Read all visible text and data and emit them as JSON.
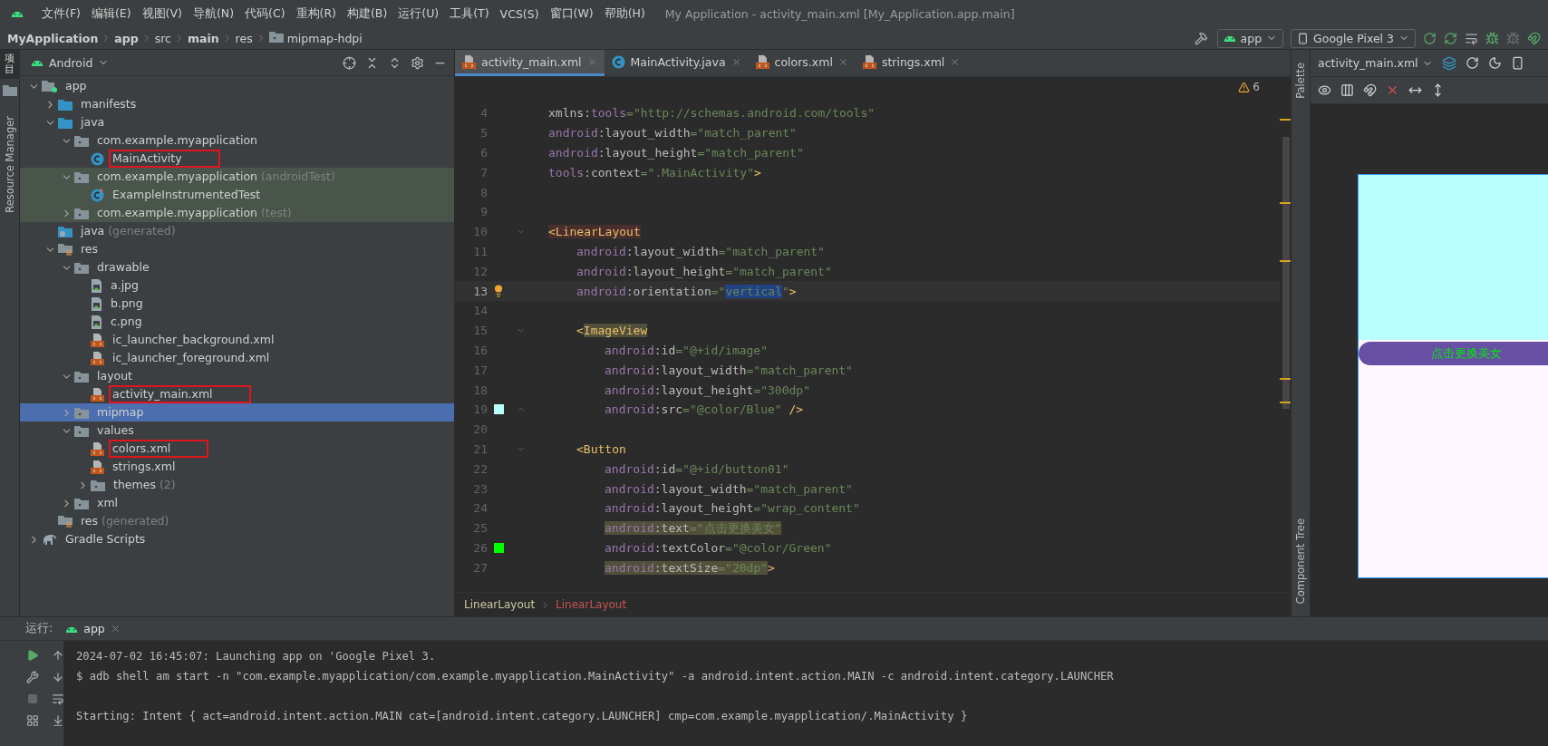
{
  "menu_bar": {
    "items": [
      "文件(F)",
      "编辑(E)",
      "视图(V)",
      "导航(N)",
      "代码(C)",
      "重构(R)",
      "构建(B)",
      "运行(U)",
      "工具(T)",
      "VCS(S)",
      "窗口(W)",
      "帮助(H)"
    ],
    "title": "My Application - activity_main.xml [My_Application.app.main]"
  },
  "breadcrumb": [
    {
      "label": "MyApplication",
      "bold": true
    },
    {
      "label": "app",
      "bold": true
    },
    {
      "label": "src",
      "bold": false
    },
    {
      "label": "main",
      "bold": true
    },
    {
      "label": "res",
      "bold": false
    },
    {
      "label": "mipmap-hdpi",
      "bold": false,
      "kind": "folder"
    }
  ],
  "run_toolbar": {
    "config": "app",
    "device": "Google Pixel 3"
  },
  "side_tabs": {
    "project": "项目",
    "resources": "Resource Manager"
  },
  "project_panel": {
    "view": "Android",
    "tree": [
      {
        "label": "app",
        "kind": "module",
        "expanded": true,
        "selected": false,
        "marked": false,
        "test": false,
        "children": [
          {
            "label": "manifests",
            "kind": "folder",
            "expanded": false,
            "selected": false,
            "marked": false,
            "test": false
          },
          {
            "label": "java",
            "kind": "folder",
            "expanded": true,
            "selected": false,
            "marked": false,
            "test": false,
            "children": [
              {
                "label": "com.example.myapplication",
                "kind": "package",
                "expanded": true,
                "selected": false,
                "marked": false,
                "test": false,
                "children": [
                  {
                    "label": "MainActivity",
                    "kind": "class",
                    "selected": false,
                    "marked": true,
                    "test": false
                  }
                ]
              },
              {
                "label": "com.example.myapplication",
                "note": "(androidTest)",
                "kind": "package",
                "expanded": true,
                "selected": false,
                "marked": false,
                "test": true,
                "children": [
                  {
                    "label": "ExampleInstrumentedTest",
                    "kind": "testclass",
                    "selected": false,
                    "marked": false,
                    "test": true
                  }
                ]
              },
              {
                "label": "com.example.myapplication",
                "note": "(test)",
                "kind": "package",
                "expanded": false,
                "selected": false,
                "marked": false,
                "test": true
              }
            ]
          },
          {
            "label": "java",
            "note": "(generated)",
            "kind": "genfolder",
            "selected": false,
            "marked": false,
            "test": false
          },
          {
            "label": "res",
            "kind": "resfolder",
            "expanded": true,
            "selected": false,
            "marked": false,
            "test": false,
            "children": [
              {
                "label": "drawable",
                "kind": "package",
                "expanded": true,
                "selected": false,
                "marked": false,
                "test": false,
                "children": [
                  {
                    "label": "a.jpg",
                    "kind": "image",
                    "selected": false,
                    "marked": false,
                    "test": false
                  },
                  {
                    "label": "b.png",
                    "kind": "image",
                    "selected": false,
                    "marked": false,
                    "test": false
                  },
                  {
                    "label": "c.png",
                    "kind": "image",
                    "selected": false,
                    "marked": false,
                    "test": false
                  },
                  {
                    "label": "ic_launcher_background.xml",
                    "kind": "xml",
                    "selected": false,
                    "marked": false,
                    "test": false
                  },
                  {
                    "label": "ic_launcher_foreground.xml",
                    "kind": "xml",
                    "selected": false,
                    "marked": false,
                    "test": false
                  }
                ]
              },
              {
                "label": "layout",
                "kind": "package",
                "expanded": true,
                "selected": false,
                "marked": false,
                "test": false,
                "children": [
                  {
                    "label": "activity_main.xml",
                    "kind": "xml",
                    "selected": false,
                    "marked": true,
                    "test": false
                  }
                ]
              },
              {
                "label": "mipmap",
                "kind": "package",
                "expanded": false,
                "selected": true,
                "marked": false,
                "test": false
              },
              {
                "label": "values",
                "kind": "package",
                "expanded": true,
                "selected": false,
                "marked": false,
                "test": false,
                "children": [
                  {
                    "label": "colors.xml",
                    "kind": "xml",
                    "selected": false,
                    "marked": true,
                    "test": false
                  },
                  {
                    "label": "strings.xml",
                    "kind": "xml",
                    "selected": false,
                    "marked": false,
                    "test": false
                  },
                  {
                    "label": "themes",
                    "note": "(2)",
                    "kind": "package",
                    "expanded": false,
                    "selected": false,
                    "marked": false,
                    "test": false
                  }
                ]
              },
              {
                "label": "xml",
                "kind": "package",
                "expanded": false,
                "selected": false,
                "marked": false,
                "test": false
              }
            ]
          },
          {
            "label": "res",
            "note": "(generated)",
            "kind": "resfolder",
            "selected": false,
            "marked": false,
            "test": false
          }
        ]
      },
      {
        "label": "Gradle Scripts",
        "kind": "gradle",
        "expanded": false,
        "selected": false,
        "marked": false,
        "test": false
      }
    ]
  },
  "editor": {
    "tabs": [
      {
        "label": "activity_main.xml",
        "kind": "xml",
        "selected": true
      },
      {
        "label": "MainActivity.java",
        "kind": "class",
        "selected": false
      },
      {
        "label": "colors.xml",
        "kind": "xml",
        "selected": false
      },
      {
        "label": "strings.xml",
        "kind": "xml",
        "selected": false
      }
    ],
    "warnings": "6",
    "lines": [
      {
        "n": "4",
        "tokens": [
          {
            "kind": "attr",
            "text": "xmlns:"
          },
          {
            "kind": "ns",
            "text": "tools"
          },
          {
            "kind": "str",
            "text": "=\"http://schemas.android.com/tools\""
          }
        ]
      },
      {
        "n": "5",
        "tokens": [
          {
            "kind": "ns",
            "text": "android"
          },
          {
            "kind": "attr",
            "text": ":layout_width"
          },
          {
            "kind": "str",
            "text": "=\"match_parent\""
          }
        ]
      },
      {
        "n": "6",
        "tokens": [
          {
            "kind": "ns",
            "text": "android"
          },
          {
            "kind": "attr",
            "text": ":layout_height"
          },
          {
            "kind": "str",
            "text": "=\"match_parent\""
          }
        ]
      },
      {
        "n": "7",
        "tokens": [
          {
            "kind": "ns",
            "text": "tools"
          },
          {
            "kind": "attr",
            "text": ":context"
          },
          {
            "kind": "str",
            "text": "=\".MainActivity\""
          },
          {
            "kind": "tag",
            "text": ">"
          }
        ]
      },
      {
        "n": "8"
      },
      {
        "n": "9"
      },
      {
        "n": "10",
        "fold": {
          "kind": "start"
        },
        "tokens": [
          {
            "kind": "match",
            "text": "<LinearLayout"
          }
        ],
        "children": [
          {
            "n": "11",
            "tokens": [
              {
                "kind": "ns",
                "text": "android"
              },
              {
                "kind": "attr",
                "text": ":layout_width"
              },
              {
                "kind": "str",
                "text": "=\"match_parent\""
              }
            ]
          },
          {
            "n": "12",
            "tokens": [
              {
                "kind": "ns",
                "text": "android"
              },
              {
                "kind": "attr",
                "text": ":layout_height"
              },
              {
                "kind": "str",
                "text": "=\"match_parent\""
              }
            ]
          },
          {
            "n": "13",
            "current": true,
            "bulb": true,
            "tokens": [
              {
                "kind": "ns",
                "text": "android"
              },
              {
                "kind": "attr",
                "text": ":orientation"
              },
              {
                "kind": "str",
                "text": "=\""
              },
              {
                "kind": "sel",
                "text": "vertical"
              },
              {
                "kind": "str",
                "text": "\""
              },
              {
                "kind": "tag",
                "text": ">"
              }
            ]
          },
          {
            "n": "14"
          },
          {
            "n": "15",
            "fold": {
              "kind": "start"
            },
            "tokens": [
              {
                "kind": "tag",
                "text": "<"
              },
              {
                "kind": "taghl",
                "text": "ImageView"
              }
            ],
            "children": [
              {
                "n": "16",
                "tokens": [
                  {
                    "kind": "ns",
                    "text": "android"
                  },
                  {
                    "kind": "attr",
                    "text": ":id"
                  },
                  {
                    "kind": "str",
                    "text": "=\"@+id/image\""
                  }
                ]
              },
              {
                "n": "17",
                "tokens": [
                  {
                    "kind": "ns",
                    "text": "android"
                  },
                  {
                    "kind": "attr",
                    "text": ":layout_width"
                  },
                  {
                    "kind": "str",
                    "text": "=\"match_parent\""
                  }
                ]
              },
              {
                "n": "18",
                "tokens": [
                  {
                    "kind": "ns",
                    "text": "android"
                  },
                  {
                    "kind": "attr",
                    "text": ":layout_height"
                  },
                  {
                    "kind": "str",
                    "text": "=\"300dp\""
                  }
                ]
              },
              {
                "n": "19",
                "fold": {
                  "kind": "end"
                },
                "color": "#b9fffe",
                "tokens": [
                  {
                    "kind": "ns",
                    "text": "android"
                  },
                  {
                    "kind": "attr",
                    "text": ":src"
                  },
                  {
                    "kind": "str",
                    "text": "=\"@color/Blue\""
                  },
                  {
                    "kind": "tag",
                    "text": " />"
                  }
                ]
              }
            ]
          },
          {
            "n": "20"
          },
          {
            "n": "21",
            "fold": {
              "kind": "start"
            },
            "tokens": [
              {
                "kind": "tag",
                "text": "<Button"
              }
            ],
            "children": [
              {
                "n": "22",
                "tokens": [
                  {
                    "kind": "ns",
                    "text": "android"
                  },
                  {
                    "kind": "attr",
                    "text": ":id"
                  },
                  {
                    "kind": "str",
                    "text": "=\"@+id/button01\""
                  }
                ]
              },
              {
                "n": "23",
                "tokens": [
                  {
                    "kind": "ns",
                    "text": "android"
                  },
                  {
                    "kind": "attr",
                    "text": ":layout_width"
                  },
                  {
                    "kind": "str",
                    "text": "=\"match_parent\""
                  }
                ]
              },
              {
                "n": "24",
                "tokens": [
                  {
                    "kind": "ns",
                    "text": "android"
                  },
                  {
                    "kind": "attr",
                    "text": ":layout_height"
                  },
                  {
                    "kind": "str",
                    "text": "=\"wrap_content\""
                  }
                ]
              },
              {
                "n": "25",
                "warn": true,
                "tokens": [
                  {
                    "kind": "ns",
                    "text": "android"
                  },
                  {
                    "kind": "attr",
                    "text": ":text"
                  },
                  {
                    "kind": "str",
                    "text": "=\"点击更换美女\""
                  }
                ]
              },
              {
                "n": "26",
                "color": "#00ff00",
                "tokens": [
                  {
                    "kind": "ns",
                    "text": "android"
                  },
                  {
                    "kind": "attr",
                    "text": ":textColor"
                  },
                  {
                    "kind": "str",
                    "text": "=\"@color/Green\""
                  }
                ]
              },
              {
                "n": "27",
                "warn": true,
                "tokens": [
                  {
                    "kind": "ns",
                    "text": "android"
                  },
                  {
                    "kind": "attr",
                    "text": ":textSize"
                  },
                  {
                    "kind": "str",
                    "text": "=\"20dp\""
                  }
                ],
                "tail": [
                  {
                    "kind": "tag",
                    "text": ">"
                  }
                ]
              }
            ]
          }
        ]
      }
    ],
    "path": [
      "LinearLayout",
      "LinearLayout"
    ]
  },
  "design": {
    "side_tabs": [
      "Palette",
      "Component Tree"
    ],
    "file": "activity_main.xml",
    "button_text": "点击更换美女"
  },
  "run_panel": {
    "label": "运行:",
    "tab": "app",
    "console": [
      "2024-07-02 16:45:07: Launching app on 'Google Pixel 3.",
      "$ adb shell am start -n \"com.example.myapplication/com.example.myapplication.MainActivity\" -a android.intent.action.MAIN -c android.intent.category.LAUNCHER",
      "Starting: Intent { act=android.intent.action.MAIN cat=[android.intent.category.LAUNCHER] cmp=com.example.myapplication/.MainActivity }"
    ]
  }
}
